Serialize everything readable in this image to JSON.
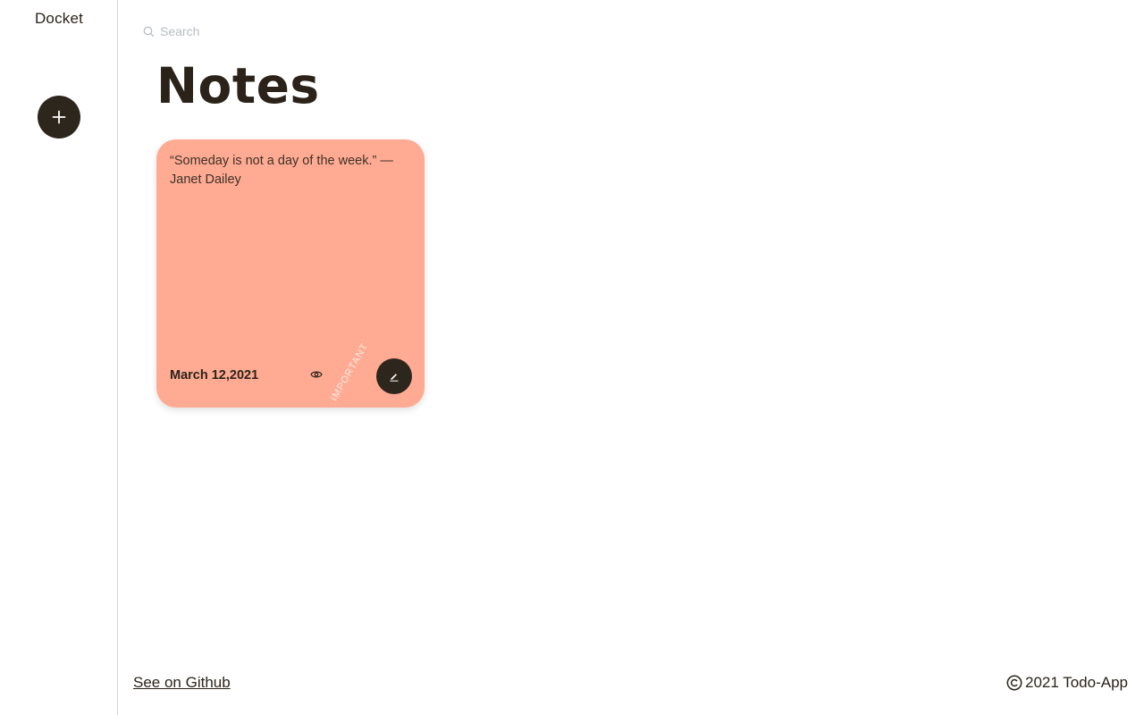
{
  "app": {
    "brand": "Docket"
  },
  "sidebar": {
    "add_icon": "plus-icon"
  },
  "search": {
    "placeholder": "Search",
    "value": "",
    "icon": "search-icon"
  },
  "main": {
    "title": "Notes"
  },
  "notes": [
    {
      "text": "“Someday is not a day of the week.” — Janet Dailey",
      "date": "March 12,2021",
      "tag": "IMPORTANT",
      "color": "#ffab93",
      "view_icon": "eye-icon",
      "edit_icon": "pencil-icon"
    }
  ],
  "footer": {
    "github_label": "See on Github",
    "copyright": "2021 Todo-App",
    "copyright_icon": "copyright-icon"
  },
  "colors": {
    "dark": "#2d261c",
    "note_salmon": "#ffab93",
    "placeholder": "#b7bcc4"
  }
}
